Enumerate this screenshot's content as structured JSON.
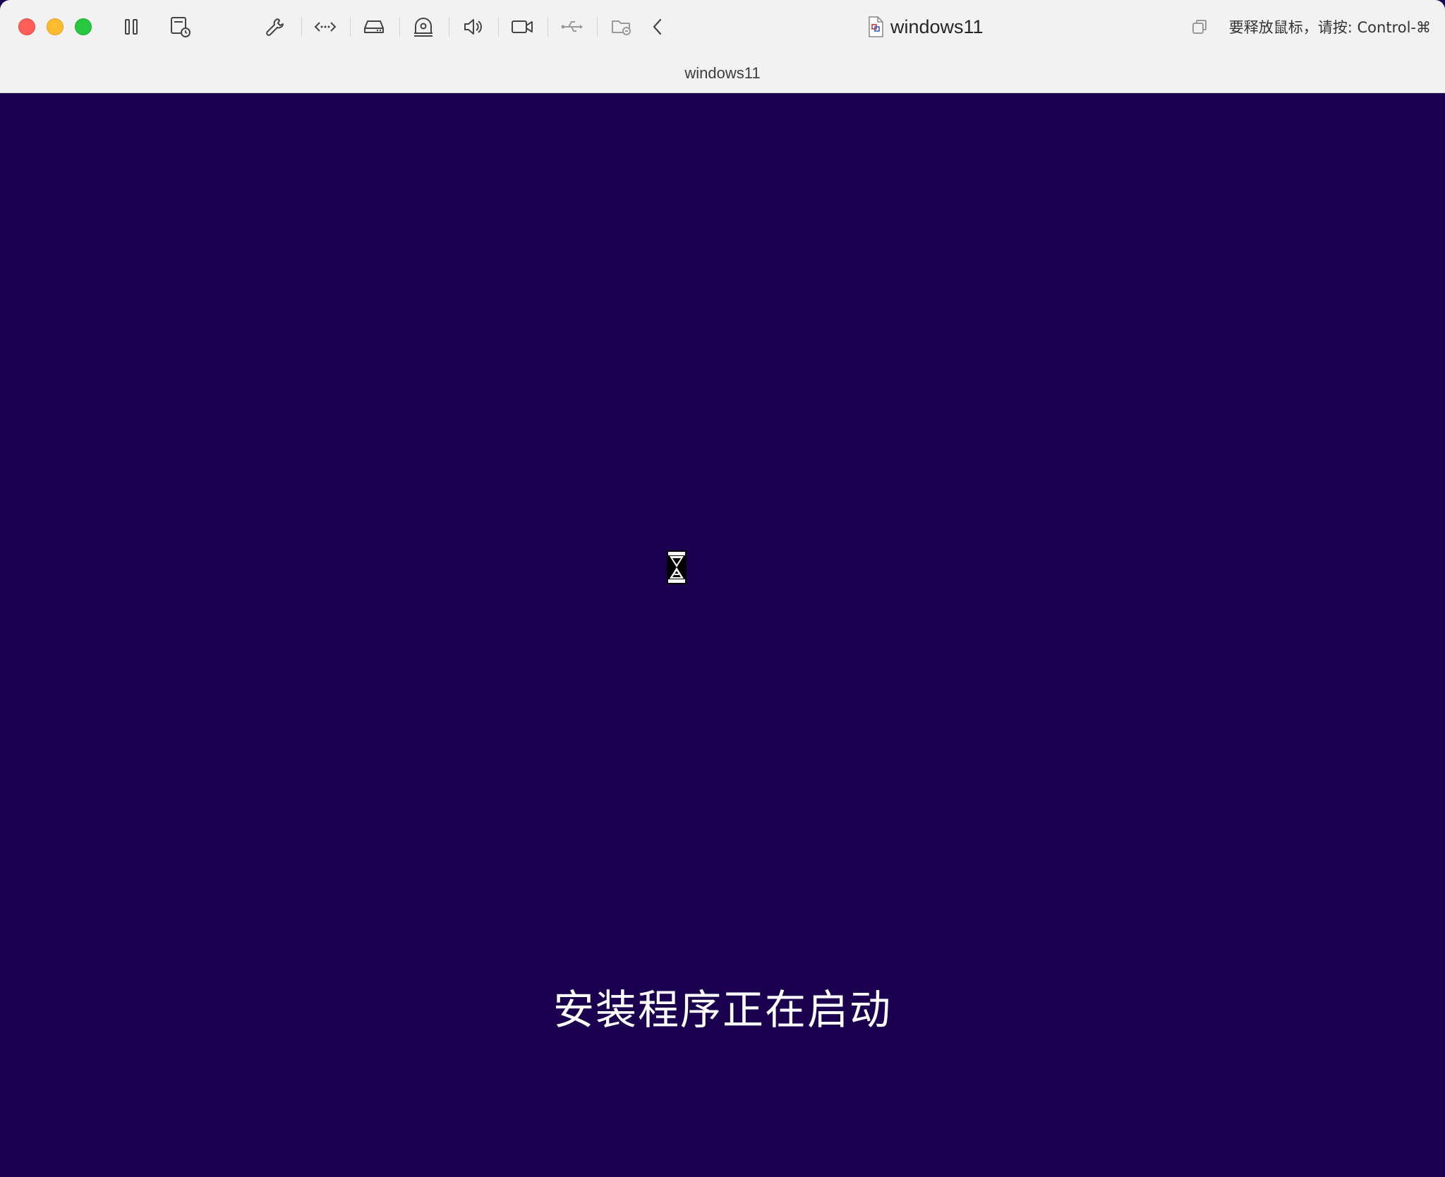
{
  "window": {
    "document_title": "windows11",
    "tab_title": "windows11",
    "release_hint": "要释放鼠标，请按: Control-⌘"
  },
  "toolbar": {
    "icons": [
      "pause-icon",
      "snapshot-icon",
      "settings-wrench-icon",
      "network-icon",
      "hard-disk-icon",
      "cd-dvd-icon",
      "sound-icon",
      "camera-icon",
      "usb-icon",
      "shared-folder-icon",
      "collapse-chevron-icon"
    ]
  },
  "vm": {
    "status_text": "安装程序正在启动",
    "background_color": "#1c0050",
    "cursor": "hourglass-icon"
  },
  "colors": {
    "close": "#ff5f57",
    "minimize": "#febc2e",
    "maximize": "#28c840"
  }
}
